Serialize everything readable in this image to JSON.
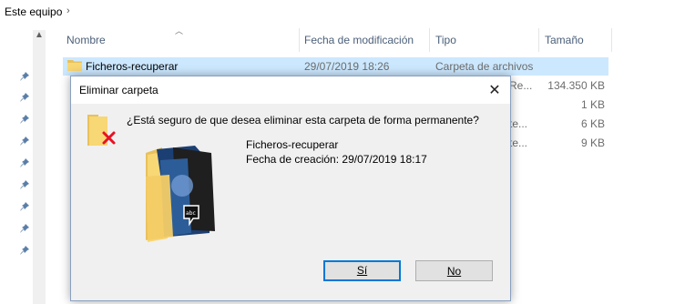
{
  "breadcrumb": {
    "label": "Este equipo",
    "arrow": "›"
  },
  "columns": {
    "name": "Nombre",
    "date": "Fecha de modificación",
    "type": "Tipo",
    "size": "Tamaño"
  },
  "rows": [
    {
      "name": "Ficheros-recuperar",
      "date": "29/07/2019 18:26",
      "type": "Carpeta de archivos",
      "size": ""
    },
    {
      "name": "",
      "date": "",
      "type": "Re...",
      "size": "134.350 KB"
    },
    {
      "name": "",
      "date": "",
      "type": "",
      "size": "1 KB"
    },
    {
      "name": "",
      "date": "",
      "type": "te...",
      "size": "6 KB"
    },
    {
      "name": "",
      "date": "",
      "type": "te...",
      "size": "9 KB"
    }
  ],
  "dialog": {
    "title": "Eliminar carpeta",
    "close_glyph": "✕",
    "question": "¿Está seguro de que desea eliminar esta carpeta de forma permanente?",
    "item_name": "Ficheros-recuperar",
    "created": "Fecha de creación: 29/07/2019 18:17",
    "yes_label": "Sí",
    "no_label": "No",
    "accent_color": "#0078d7",
    "delete_color": "#e81123"
  }
}
